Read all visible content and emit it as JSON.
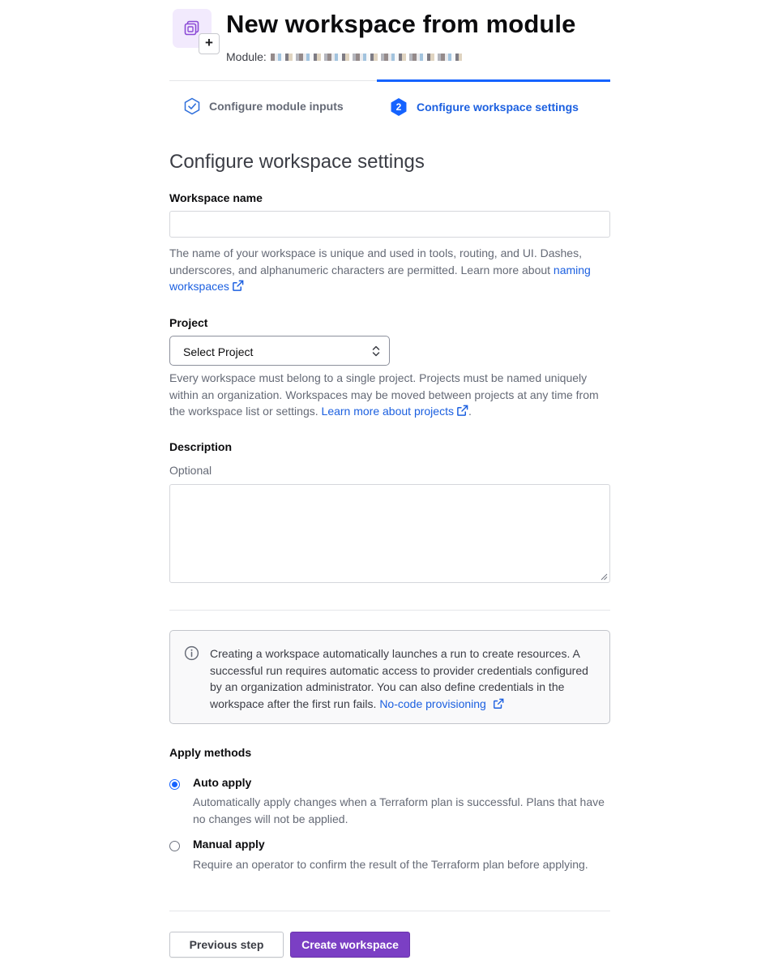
{
  "colors": {
    "accent": "#1563ff",
    "link": "#1c60e0",
    "primary_button": "#7b3fc4",
    "logo_background": "#f2eafd"
  },
  "header": {
    "title": "New workspace from module",
    "module_label": "Module:",
    "logo_icon": "workspace-module-icon",
    "plus_glyph": "+"
  },
  "steps": [
    {
      "number": "1",
      "label": "Configure module inputs",
      "state": "completed",
      "icon": "check-hexagon-icon"
    },
    {
      "number": "2",
      "label": "Configure workspace settings",
      "state": "current"
    }
  ],
  "form": {
    "section_title": "Configure workspace settings",
    "workspace_name": {
      "label": "Workspace name",
      "value": "",
      "help_text": "The name of your workspace is unique and used in tools, routing, and UI. Dashes, underscores, and alphanumeric characters are permitted. Learn more about ",
      "help_link": "naming workspaces"
    },
    "project": {
      "label": "Project",
      "selected": "Select Project",
      "help_text": "Every workspace must belong to a single project. Projects must be named uniquely within an organization. Workspaces may be moved between projects at any time from the workspace list or settings. ",
      "help_link": "Learn more about projects",
      "help_suffix": "."
    },
    "description": {
      "label": "Description",
      "hint": "Optional",
      "value": ""
    },
    "callout": {
      "text": "Creating a workspace automatically launches a run to create resources. A successful run requires automatic access to provider credentials configured by an organization administrator. You can also define credentials in the workspace after the first run fails. ",
      "link": "No-code provisioning"
    },
    "apply_methods": {
      "label": "Apply methods",
      "options": [
        {
          "label": "Auto apply",
          "description": "Automatically apply changes when a Terraform plan is successful. Plans that have no changes will not be applied.",
          "checked": true
        },
        {
          "label": "Manual apply",
          "description": "Require an operator to confirm the result of the Terraform plan before applying.",
          "checked": false
        }
      ]
    }
  },
  "actions": {
    "previous": "Previous step",
    "create": "Create workspace"
  }
}
